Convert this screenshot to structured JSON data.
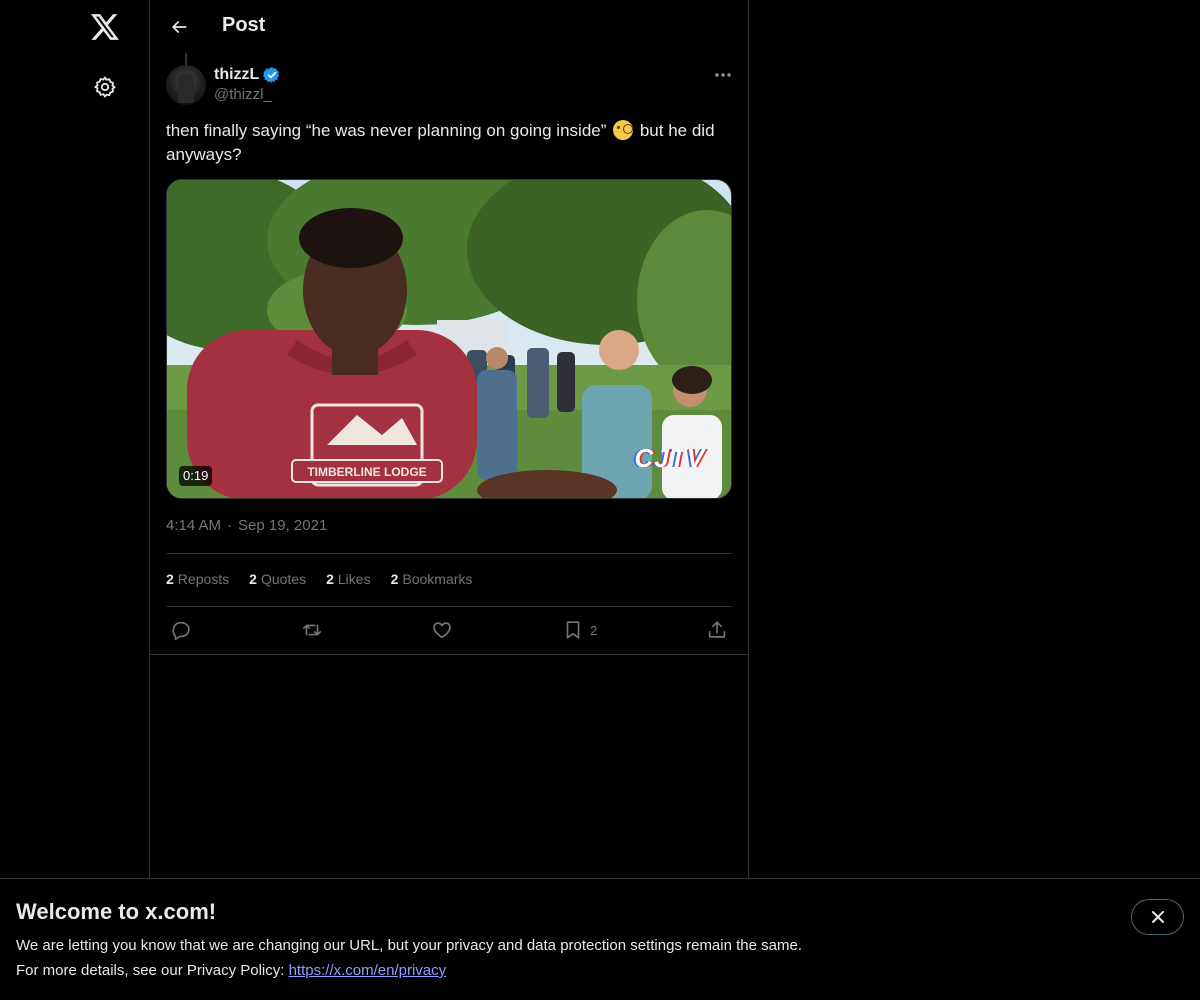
{
  "nav": {
    "logo_icon": "x-logo-icon",
    "settings_icon": "gear-icon"
  },
  "header": {
    "back_icon": "arrow-left-icon",
    "title": "Post"
  },
  "post": {
    "author_name": "thizzL",
    "author_handle": "@thizzl_",
    "verified": true,
    "text_before_emoji": "then finally saying “he was never planning on going inside” ",
    "emoji": "face-with-monocle",
    "text_after_emoji": " but he did anyways?",
    "video": {
      "duration": "0:19",
      "watermark": "CJTV",
      "shirt_text": "TIMBERLINE LODGE"
    },
    "time": "4:14 AM",
    "separator": "·",
    "date": "Sep 19, 2021",
    "stats": {
      "reposts_count": "2",
      "reposts_label": "Reposts",
      "quotes_count": "2",
      "quotes_label": "Quotes",
      "likes_count": "2",
      "likes_label": "Likes",
      "bookmarks_count": "2",
      "bookmarks_label": "Bookmarks"
    },
    "actions": {
      "bookmark_count": "2"
    }
  },
  "banner": {
    "title": "Welcome to x.com!",
    "line1": "We are letting you know that we are changing our URL, but your privacy and data protection settings remain the same.",
    "line2_prefix": "For more details, see our Privacy Policy: ",
    "link": "https://x.com/en/privacy"
  },
  "colors": {
    "background": "#000000",
    "text": "#e7e9ea",
    "muted": "#71767b",
    "border": "#2f3336",
    "verified": "#1d9bf0",
    "link": "#8e9dff"
  }
}
